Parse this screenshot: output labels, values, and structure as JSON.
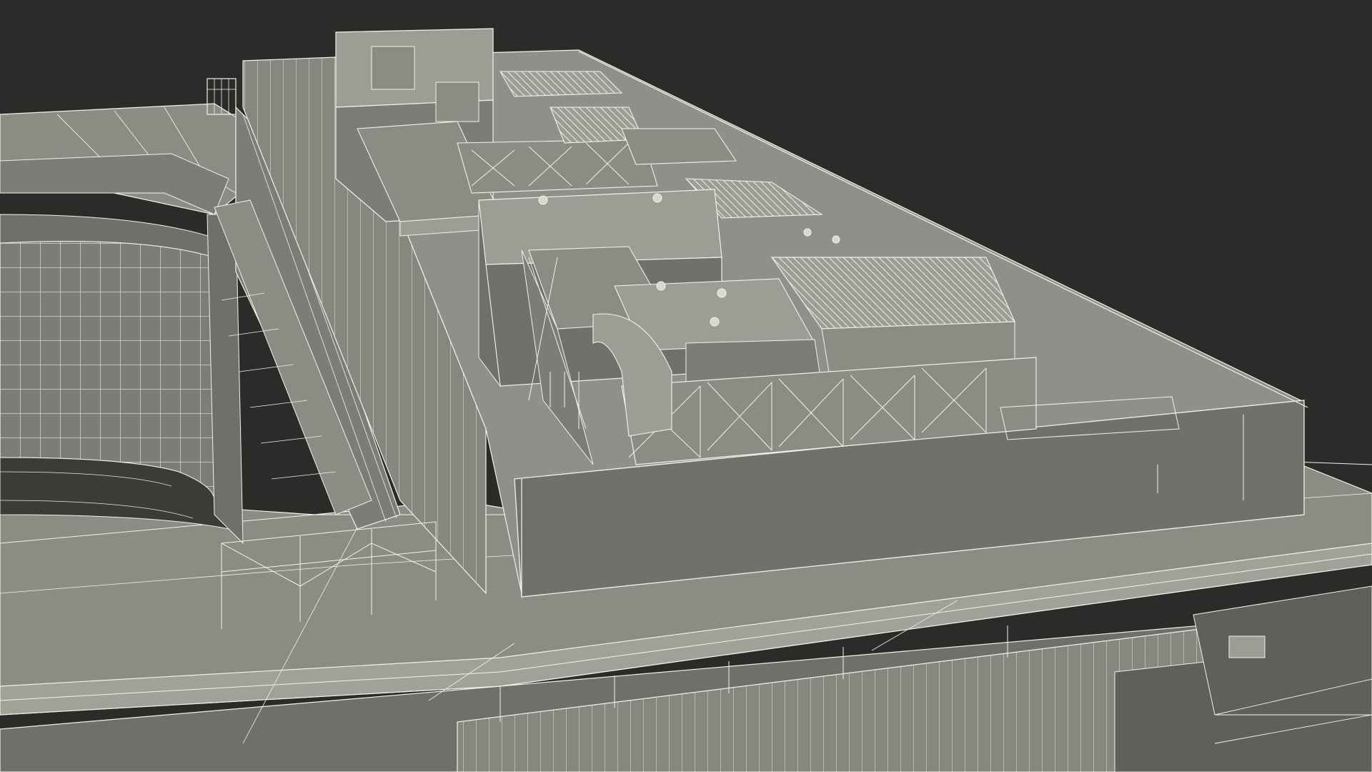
{
  "scene": {
    "subject": "wireframe-building-rooftop",
    "background_color": "#2b2b2a",
    "surface_color": "#8b8c84",
    "surface_light_color": "#a0a198",
    "surface_dark_color": "#6f7069",
    "wire_color": "#f2f2ea"
  }
}
